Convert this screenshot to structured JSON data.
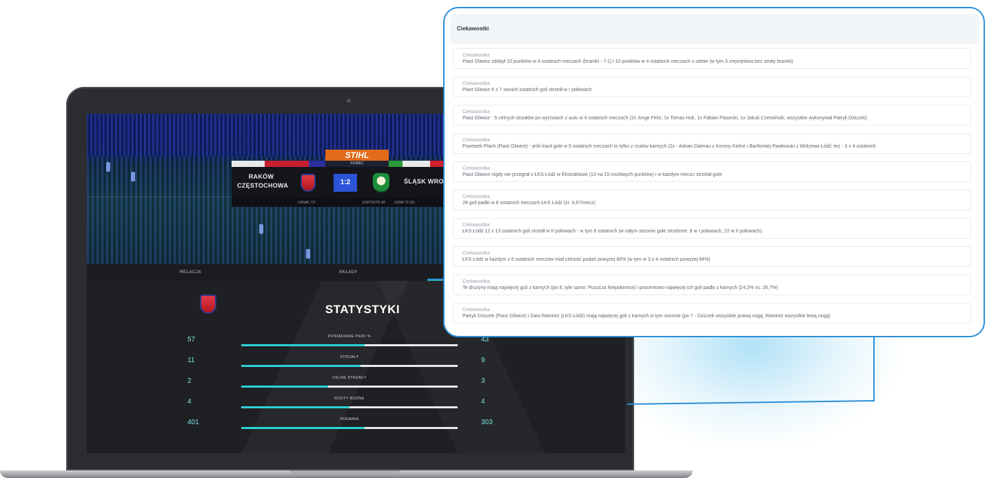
{
  "scoreboard": {
    "brand": "STIHL",
    "status": "KONIEC",
    "home_team": "RAKÓW CZĘSTOCHOWA",
    "score": "1:2",
    "away_team": "ŚLĄSK WROC",
    "home_scorer": "CRNAC 19'",
    "away_scorer_1": "EXPOSITO 49'",
    "away_scorer_2": "LEWA 75' (K)"
  },
  "tabs": [
    {
      "label": "RELACJA"
    },
    {
      "label": "SKŁADY"
    }
  ],
  "stats": {
    "title": "STATYSTYKI",
    "rows": [
      {
        "label": "POSIADANIE PIŁKI %",
        "home": "57",
        "away": "43",
        "home_share": 0.57
      },
      {
        "label": "STRZAŁY",
        "home": "11",
        "away": "9",
        "home_share": 0.55
      },
      {
        "label": "CELNE STRZAŁY",
        "home": "2",
        "away": "3",
        "home_share": 0.4
      },
      {
        "label": "RZUTY ROŻNE",
        "home": "4",
        "away": "4",
        "home_share": 0.5
      },
      {
        "label": "PODANIA",
        "home": "401",
        "away": "303",
        "home_share": 0.57
      }
    ]
  },
  "popup": {
    "header": "Ciekawostki",
    "facts": [
      {
        "title": "Ciekawostka",
        "text": "Piast Gliwice zdobył 10 punktów w 4 ostatnich meczach (bramki - 7:1) i 10 punktów w 4 ostatnich meczach u siebie (w tym 3 zwycięstwa bez straty bramki)"
      },
      {
        "title": "Ciekawostka",
        "text": "Piast Gliwice 6 z 7 swoich ostatnich goli strzelił w I połowach"
      },
      {
        "title": "Ciekawostka",
        "text": "Piast Gliwice - 5 celnych strzałów po wyrzutach z autu w 4 ostatnich meczach (2x Jorge Felix, 1x Tomas Huk, 1x Fabian Piasecki, 1x Jakub Czerwiński; wszystkie wykonywał Patryk Dziczek)"
      },
      {
        "title": "Ciekawostka",
        "text": "Frantisek Plach (Piast Gliwice) - jeśli tracił gole w 5 ostatnich meczach to tylko z rzutów karnych (2x - Adrian Dalmau z Korony Kielce i Bartłomiej Pawłowski z Widzewa Łódź; też - 3 z 4 ostatnich"
      },
      {
        "title": "Ciekawostka",
        "text": "Piast Gliwice nigdy nie przegrał z ŁKS Łódź w Ekstraklasie (13 na 15 możliwych punktów) i w każdym meczu strzelał gole"
      },
      {
        "title": "Ciekawostka",
        "text": "28 goli padło w 6 ostatnich meczach ŁKS Łódź (śr. 4,67/mecz)"
      },
      {
        "title": "Ciekawostka",
        "text": "ŁKS Łódź 12 z 13 ostatnich goli strzelił w II połowach - w tym 6 ostatnich (w całym sezonie gole strzelone: 8 w I połowach, 22 w II połowach)."
      },
      {
        "title": "Ciekawostka",
        "text": "ŁKS Łódź w każdym z 6 ostatnich meczów miał celność podań powyżej 80% (w tym w 3 z 4 ostatnich powyżej 84%)"
      },
      {
        "title": "Ciekawostka",
        "text": "Te drużyny mają najwięcej goli z karnych (po 8, tyle samo: Puszcza Niepołomice) i procentowo najwięcej ich goli padło z karnych (24,2% vs. 26,7%)"
      },
      {
        "title": "Ciekawostka",
        "text": "Patryk Dziczek (Piast Gliwice) i Dani Ramirez (ŁKS Łódź) mają najwięcej goli z karnych w tym sezonie (po 7 - Dziczek wszystkie prawą nogą, Ramirez wszystkie lewą nogą)"
      }
    ]
  },
  "colors": {
    "accent": "#2bd3d8",
    "popup_border": "#2a8fd8",
    "score_bg": "#2b54d8",
    "brand": "#e26a1b"
  }
}
